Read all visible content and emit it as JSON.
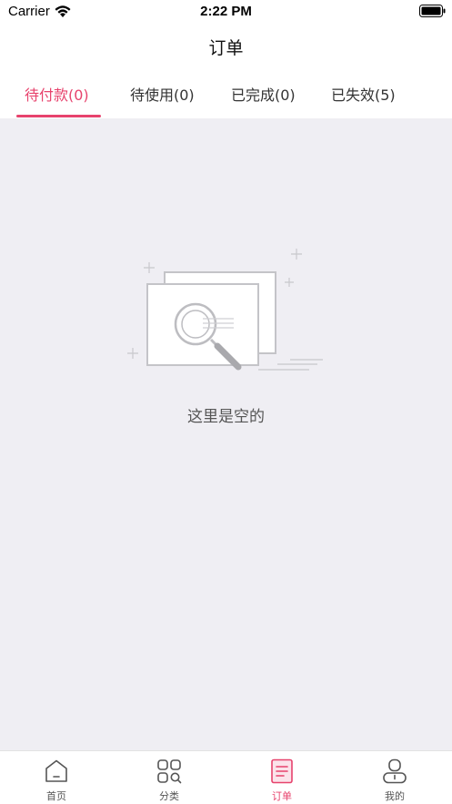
{
  "status_bar": {
    "carrier": "Carrier",
    "time": "2:22 PM"
  },
  "nav": {
    "title": "订单"
  },
  "tabs": [
    {
      "label": "待付款(0)",
      "active": true
    },
    {
      "label": "待使用(0)",
      "active": false
    },
    {
      "label": "已完成(0)",
      "active": false
    },
    {
      "label": "已失效(5)",
      "active": false
    }
  ],
  "empty_state": {
    "icon": "magnifier-document-illustration",
    "text": "这里是空的"
  },
  "tabbar": [
    {
      "label": "首页",
      "icon": "home-icon",
      "active": false
    },
    {
      "label": "分类",
      "icon": "category-icon",
      "active": false
    },
    {
      "label": "订单",
      "icon": "order-icon",
      "active": true
    },
    {
      "label": "我的",
      "icon": "profile-icon",
      "active": false
    }
  ],
  "colors": {
    "accent": "#e7436d",
    "background": "#efeef3",
    "text": "#333333"
  }
}
